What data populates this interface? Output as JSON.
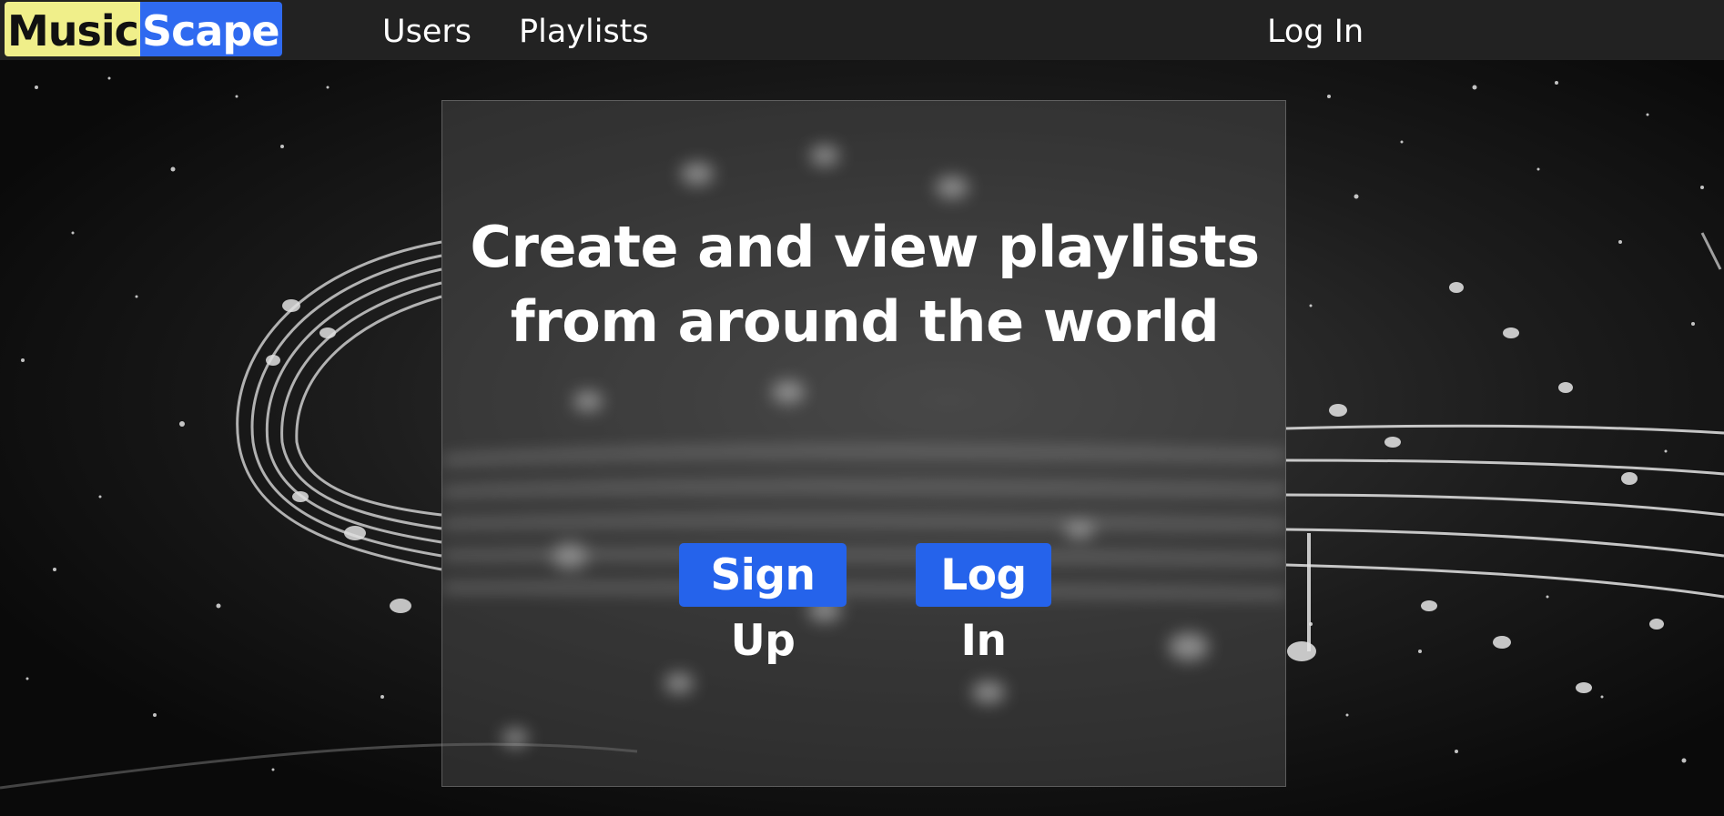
{
  "navbar": {
    "logo": {
      "part1": "Music",
      "part2": "Scape"
    },
    "links": {
      "users": "Users",
      "playlists": "Playlists",
      "login": "Log In"
    }
  },
  "hero": {
    "title_line1": "Create and view playlists",
    "title_line2": "from around the world",
    "signup_label": "Sign Up",
    "login_label": "Log In"
  },
  "colors": {
    "navbar_bg": "#222222",
    "logo_music_bg": "#f0ef8a",
    "logo_scape_bg": "#2f6af0",
    "button_bg": "#2563eb"
  },
  "background": {
    "image": "music-staff-notes-starfield"
  }
}
